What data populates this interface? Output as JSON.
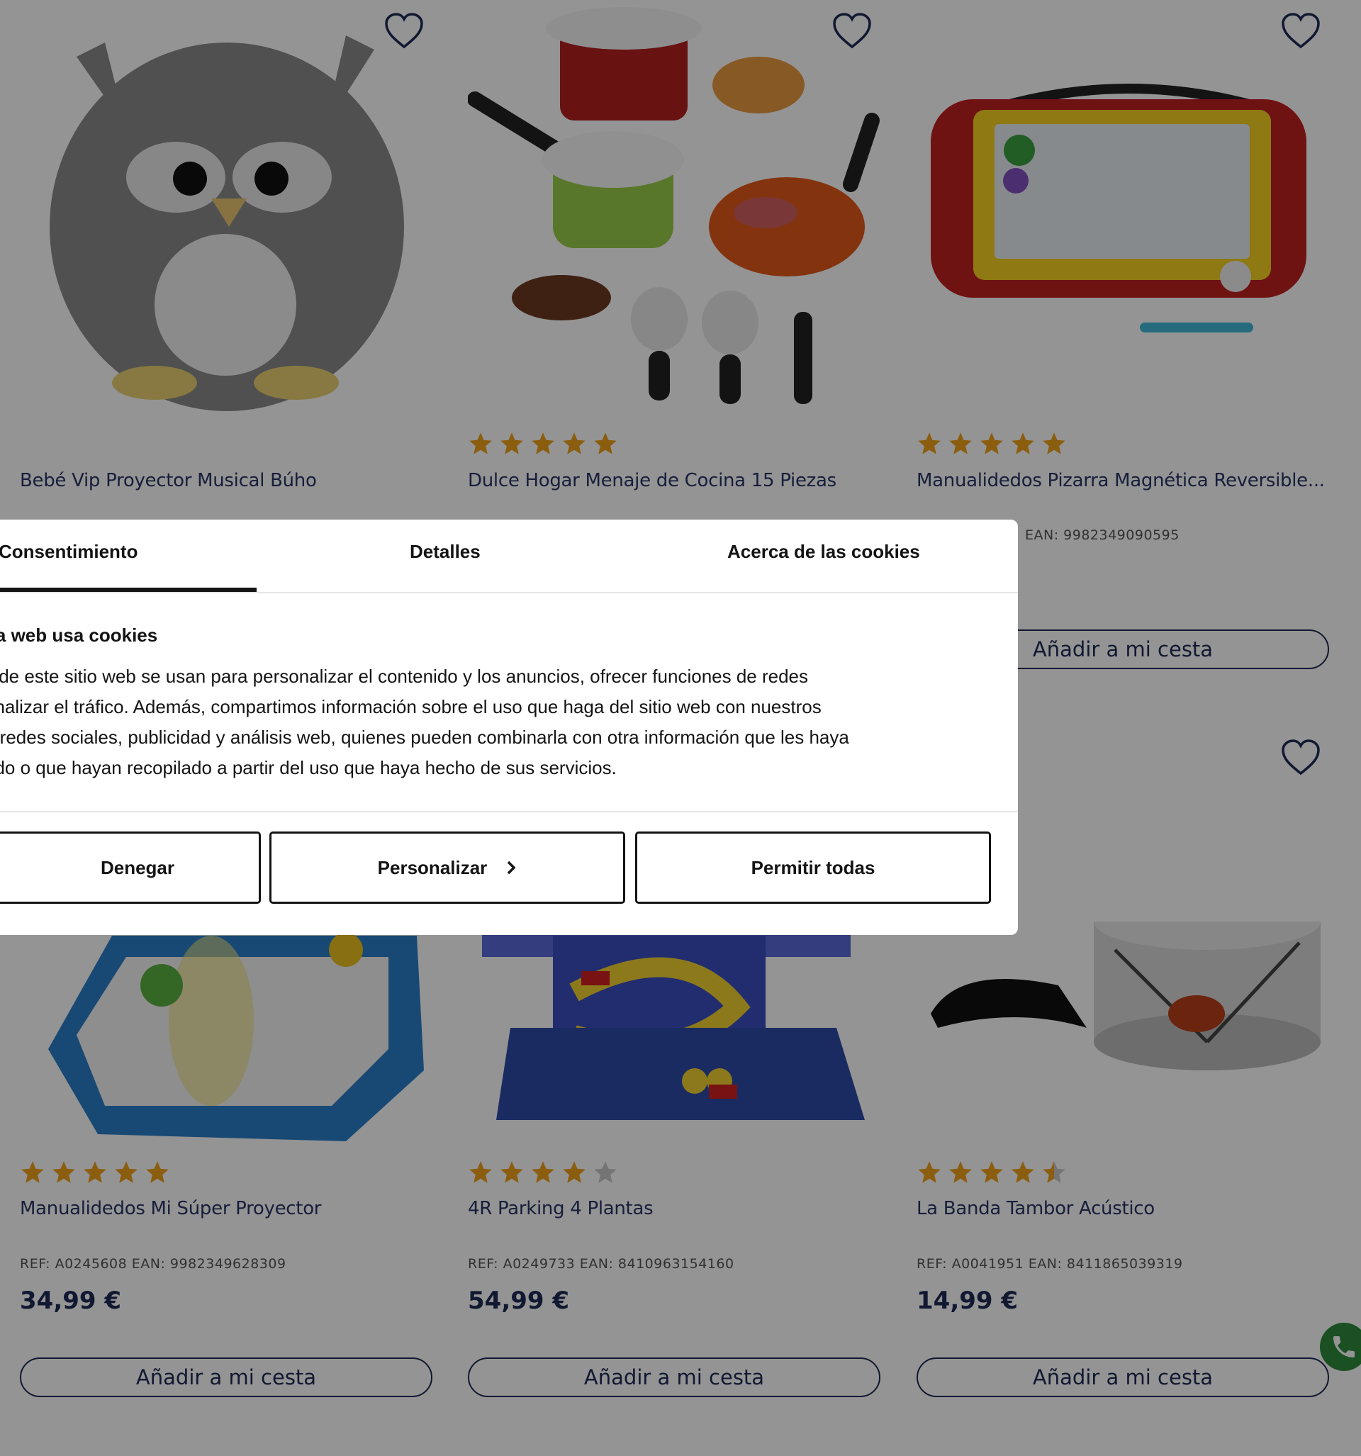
{
  "products": [
    {
      "name": "Bebé Vip Proyector Musical Búho",
      "ref": "",
      "price": "",
      "cart_label": "",
      "stars": 0
    },
    {
      "name": "Dulce Hogar Menaje de Cocina 15 Piezas",
      "ref": "",
      "price": "",
      "cart_label": "",
      "stars": 5
    },
    {
      "name": "Manualidedos Pizarra Magnética Reversible...",
      "ref": "EAN: 9982349090595",
      "price": "",
      "cart_label": "Añadir a mi cesta",
      "stars": 5
    },
    {
      "name": "Manualidedos Mi Súper Proyector",
      "ref": "REF: A0245608 EAN: 9982349628309",
      "price": "34,99 €",
      "cart_label": "Añadir a mi cesta",
      "stars": 5
    },
    {
      "name": "4R Parking 4 Plantas",
      "ref": "REF: A0249733 EAN: 8410963154160",
      "price": "54,99 €",
      "cart_label": "Añadir a mi cesta",
      "stars": 4
    },
    {
      "name": "La Banda Tambor Acústico",
      "ref": "REF: A0041951 EAN: 8411865039319",
      "price": "14,99 €",
      "cart_label": "Añadir a mi cesta",
      "stars": 4.5
    }
  ],
  "cookie_dialog": {
    "tabs": [
      "Consentimiento",
      "Detalles",
      "Acerca de las cookies"
    ],
    "active_tab": "Consentimiento",
    "title": "na web usa cookies",
    "body_lines": [
      "s de este sitio web se usan para personalizar el contenido y los anuncios, ofrecer funciones de redes",
      "analizar el tráfico. Además, compartimos información sobre el uso que haga del sitio web con nuestros",
      "e redes sociales, publicidad y análisis web, quienes pueden combinarla con otra información que les haya",
      "ado o que hayan recopilado a partir del uso que haya hecho de sus servicios."
    ],
    "buttons": {
      "deny": "Denegar",
      "customize": "Personalizar",
      "allow_all": "Permitir todas"
    }
  },
  "colors": {
    "star": "#f0a11a",
    "star_empty": "#c8c8c8",
    "navy": "#1e2a55",
    "whatsapp": "#2e8b3c"
  }
}
